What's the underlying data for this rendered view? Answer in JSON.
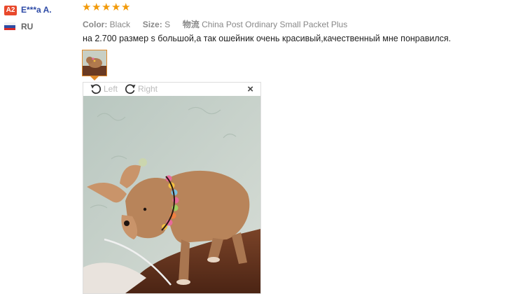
{
  "reviewer": {
    "badge": "A2",
    "name": "E***a A.",
    "country": "RU"
  },
  "rating": {
    "stars": 5,
    "max": 5
  },
  "attributes": {
    "color_label": "Color:",
    "color_value": "Black",
    "size_label": "Size:",
    "size_value": "S",
    "shipping_icon_text": "物流",
    "shipping_value": "China Post Ordinary Small Packet Plus"
  },
  "review_text": "на 2.700 размер s большой,а так ошейник очень красивый,качественный мне понравился.",
  "viewer": {
    "rotate_left": "Left",
    "rotate_right": "Right",
    "close": "×"
  },
  "colors": {
    "name": "#2d4aa6",
    "star": "#f29a0a",
    "badge": "#e8482b",
    "thumb_border": "#e08a2a"
  }
}
